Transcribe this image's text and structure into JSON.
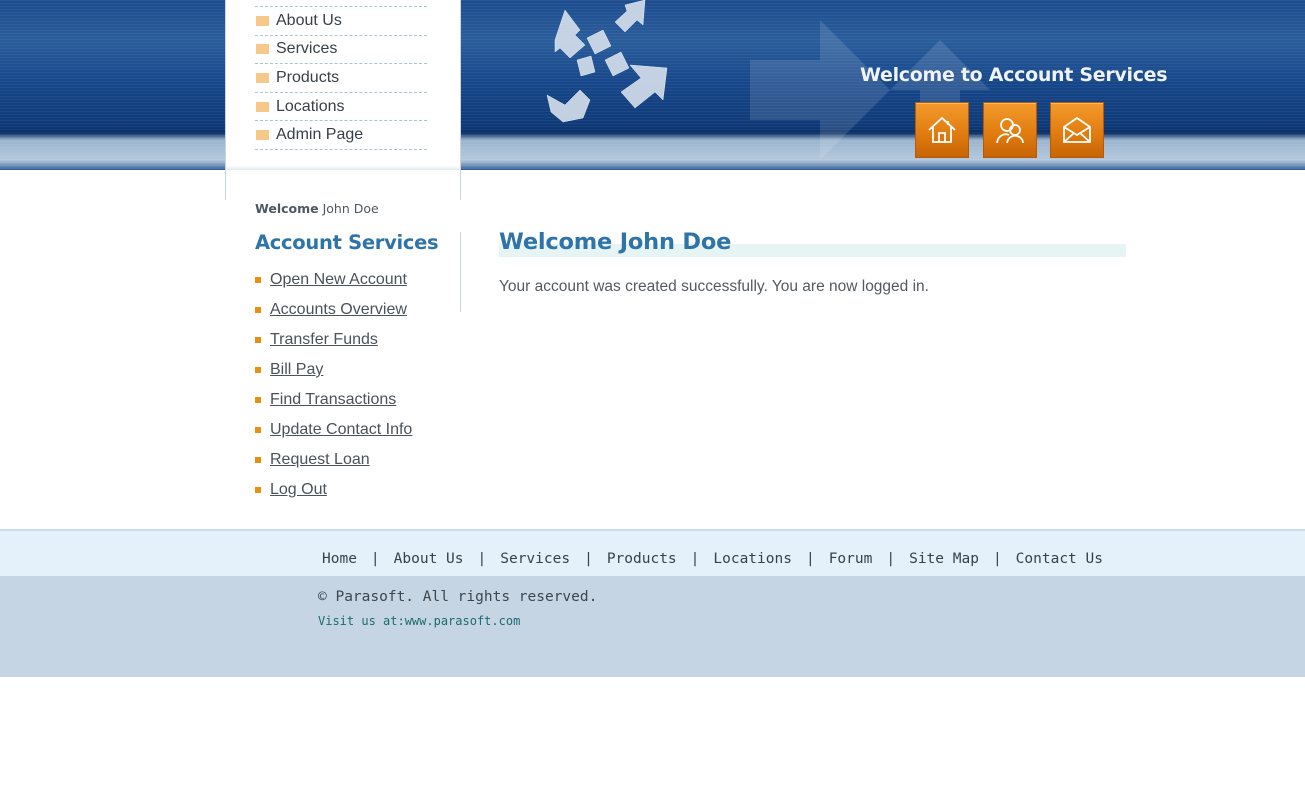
{
  "header": {
    "banner": "Welcome to Account Services",
    "buttons": [
      {
        "name": "home",
        "icon": "home-icon"
      },
      {
        "name": "about",
        "icon": "people-icon"
      },
      {
        "name": "contact",
        "icon": "envelope-icon"
      }
    ],
    "menu": [
      {
        "label": "About Us"
      },
      {
        "label": "Services"
      },
      {
        "label": "Products"
      },
      {
        "label": "Locations"
      },
      {
        "label": "Admin Page"
      }
    ]
  },
  "left_panel": {
    "welcome_word": "Welcome",
    "user_name": "John Doe",
    "title": "Account Services",
    "links": [
      {
        "label": "Open New Account"
      },
      {
        "label": "Accounts Overview"
      },
      {
        "label": "Transfer Funds"
      },
      {
        "label": "Bill Pay"
      },
      {
        "label": "Find Transactions"
      },
      {
        "label": "Update Contact Info"
      },
      {
        "label": "Request Loan"
      },
      {
        "label": "Log Out"
      }
    ]
  },
  "main": {
    "title": "Welcome John Doe",
    "message": "Your account was created successfully. You are now logged in."
  },
  "footer": {
    "nav": [
      {
        "label": "Home"
      },
      {
        "label": "About Us"
      },
      {
        "label": "Services"
      },
      {
        "label": "Products"
      },
      {
        "label": "Locations"
      },
      {
        "label": "Forum"
      },
      {
        "label": "Site Map"
      },
      {
        "label": "Contact Us"
      }
    ],
    "separator": "|",
    "copyright": "© Parasoft. All rights reserved.",
    "visit_label": "Visit us at:",
    "visit_link": "www.parasoft.com"
  },
  "colors": {
    "header_blue": "#164689",
    "accent_orange": "#e27d10",
    "title_blue": "#2f74a9",
    "footer_light": "#e4f1fb",
    "footer_dark": "#c6d5e4"
  }
}
